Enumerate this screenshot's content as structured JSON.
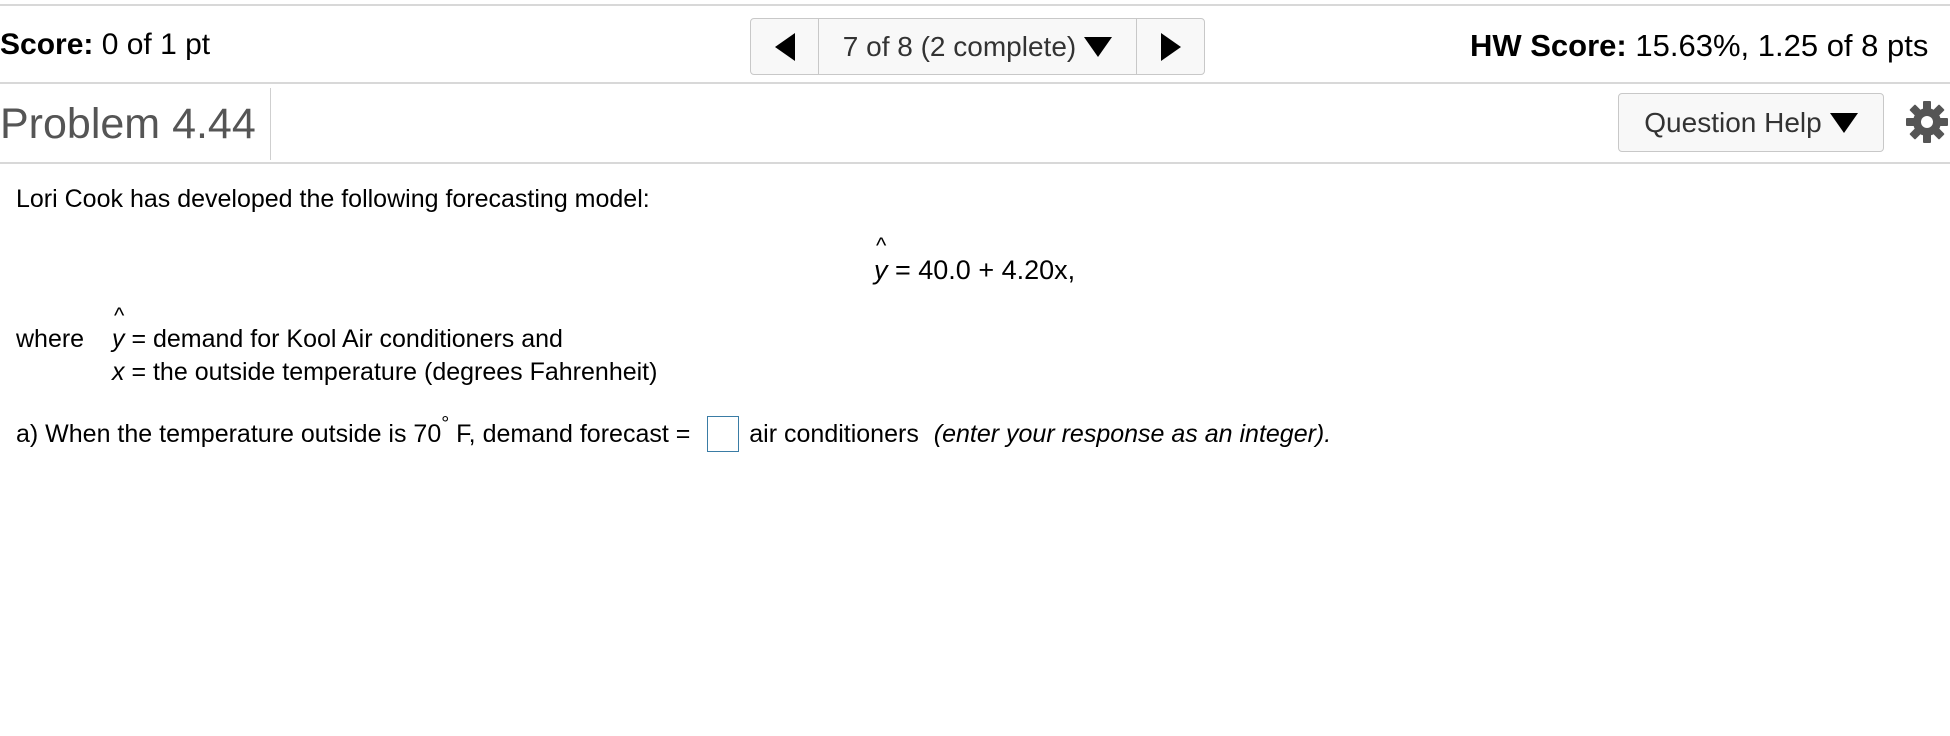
{
  "score": {
    "label": "Score:",
    "value": "0 of 1 pt"
  },
  "navigation": {
    "position": "7 of 8 (2 complete)"
  },
  "hw_score": {
    "label": "HW Score:",
    "value": "15.63%, 1.25 of 8 pts"
  },
  "problem": {
    "title": "Problem 4.44"
  },
  "help": {
    "label": "Question Help"
  },
  "content": {
    "intro": "Lori Cook has developed the following forecasting model:",
    "equation_var": "y",
    "equation_rest": " = 40.0 + 4.20x,",
    "where_label": "where",
    "def1_var": "y",
    "def1_text": " = demand for Kool Air conditioners and",
    "def2_var": "x",
    "def2_text": " = the outside temperature (degrees Fahrenheit)",
    "question_prefix": "a) When the temperature outside is 70",
    "degree_symbol": "°",
    "question_mid": " F, demand forecast = ",
    "question_suffix": "air conditioners ",
    "question_hint": "(enter your response as an integer).",
    "answer_value": ""
  },
  "icons": {
    "prev": "triangle-left-icon",
    "next": "triangle-right-icon",
    "dropdown": "triangle-down-icon",
    "settings": "gear-icon"
  }
}
